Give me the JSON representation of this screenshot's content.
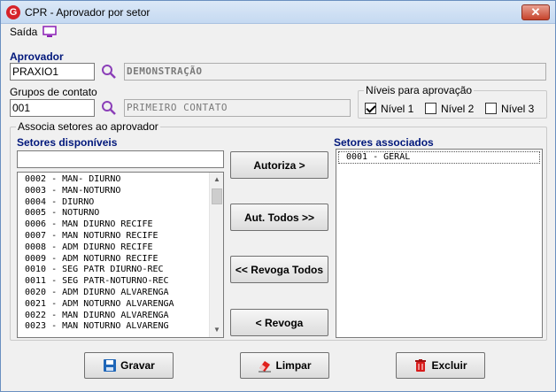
{
  "window": {
    "title": "CPR - Aprovador por setor",
    "close_label": "✕"
  },
  "menu": {
    "saida": "Saída"
  },
  "aprovador": {
    "label": "Aprovador",
    "code": "PRAXIO1",
    "name": "DEMONSTRAÇÃO"
  },
  "grupos": {
    "label": "Grupos de contato",
    "code": "001",
    "name": "PRIMEIRO CONTATO"
  },
  "niveis": {
    "title": "Níveis para aprovação",
    "options": [
      {
        "label": "Nível 1",
        "checked": true
      },
      {
        "label": "Nível 2",
        "checked": false
      },
      {
        "label": "Nível 3",
        "checked": false
      }
    ]
  },
  "associa": {
    "title": "Associa setores ao aprovador",
    "disponiveis_label": "Setores disponíveis",
    "associados_label": "Setores associados",
    "filter_value": "",
    "disponiveis": [
      "0002 - MAN- DIURNO",
      "0003 - MAN-NOTURNO",
      "0004 - DIURNO",
      "0005 - NOTURNO",
      "0006 - MAN DIURNO RECIFE",
      "0007 - MAN NOTURNO RECIFE",
      "0008 - ADM DIURNO RECIFE",
      "0009 - ADM NOTURNO RECIFE",
      "0010 - SEG PATR DIURNO-REC",
      "0011 - SEG PATR-NOTURNO-REC",
      "0020 - ADM DIURNO ALVARENGA",
      "0021 - ADM NOTURNO ALVARENGA",
      "0022 - MAN DIURNO ALVARENGA",
      "0023 - MAN NOTURNO ALVARENG"
    ],
    "associados": [
      "0001 - GERAL"
    ],
    "buttons": {
      "autoriza": "Autoriza >",
      "aut_todos": "Aut. Todos >>",
      "revoga_todos": "<< Revoga Todos",
      "revoga": "< Revoga"
    }
  },
  "footer": {
    "gravar": "Gravar",
    "limpar": "Limpar",
    "excluir": "Excluir"
  }
}
